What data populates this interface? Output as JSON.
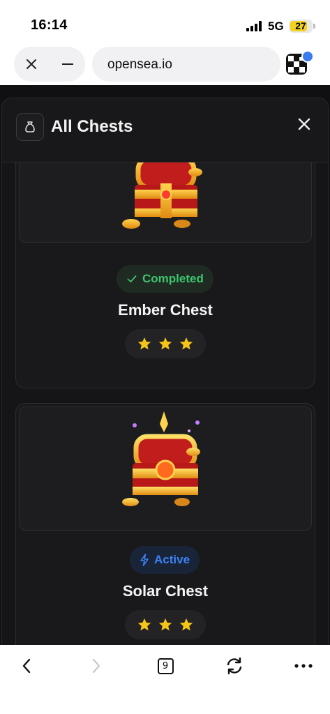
{
  "status_bar": {
    "time": "16:14",
    "network": "5G",
    "battery": "27",
    "battery_color": "#f2d21f"
  },
  "browser": {
    "url": "opensea.io",
    "tab_count": "9"
  },
  "modal": {
    "title": "All Chests",
    "header_icon": "bag-icon",
    "close_icon": "close-icon"
  },
  "chests": [
    {
      "name": "Ember Chest",
      "status": "Completed",
      "status_icon": "check-icon",
      "status_color": "#3ec46d",
      "stars": 3
    },
    {
      "name": "Solar Chest",
      "status": "Active",
      "status_icon": "lightning-icon",
      "status_color": "#3b82f6",
      "stars": 3
    }
  ],
  "colors": {
    "star": "#f5c518",
    "background": "#101012",
    "card": "#19191b"
  }
}
